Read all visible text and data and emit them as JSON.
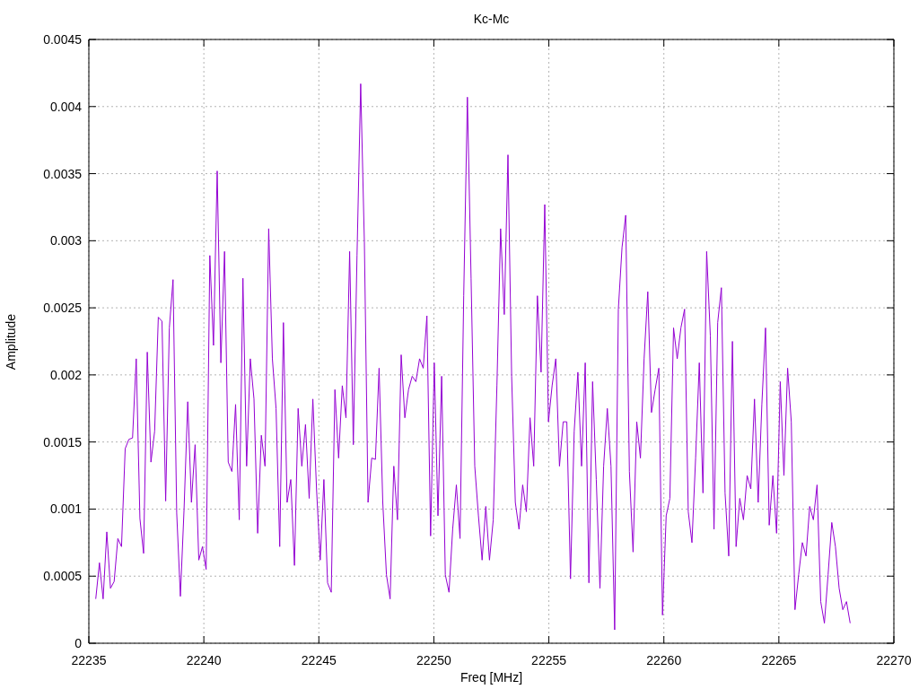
{
  "chart_data": {
    "type": "line",
    "title": "Kc-Mc",
    "xlabel": "Freq [MHz]",
    "ylabel": "Amplitude",
    "xlim": [
      22235,
      22270
    ],
    "ylim": [
      0,
      0.0045
    ],
    "xticks": [
      22235,
      22240,
      22245,
      22250,
      22255,
      22260,
      22265,
      22270
    ],
    "yticks": [
      0,
      0.0005,
      0.001,
      0.0015,
      0.002,
      0.0025,
      0.003,
      0.0035,
      0.004,
      0.0045
    ],
    "x": [
      22235.3,
      22235.46,
      22235.62,
      22235.78,
      22235.94,
      22236.1,
      22236.26,
      22236.42,
      22236.58,
      22236.74,
      22236.9,
      22237.06,
      22237.22,
      22237.38,
      22237.54,
      22237.7,
      22237.86,
      22238.02,
      22238.18,
      22238.34,
      22238.5,
      22238.66,
      22238.82,
      22238.98,
      22239.14,
      22239.3,
      22239.46,
      22239.62,
      22239.78,
      22239.94,
      22240.1,
      22240.26,
      22240.42,
      22240.58,
      22240.74,
      22240.9,
      22241.06,
      22241.22,
      22241.38,
      22241.54,
      22241.7,
      22241.86,
      22242.02,
      22242.18,
      22242.34,
      22242.5,
      22242.66,
      22242.82,
      22242.98,
      22243.14,
      22243.3,
      22243.46,
      22243.62,
      22243.78,
      22243.94,
      22244.1,
      22244.26,
      22244.42,
      22244.58,
      22244.74,
      22244.9,
      22245.06,
      22245.22,
      22245.38,
      22245.54,
      22245.7,
      22245.86,
      22246.02,
      22246.18,
      22246.34,
      22246.5,
      22246.66,
      22246.82,
      22246.98,
      22247.14,
      22247.3,
      22247.46,
      22247.62,
      22247.78,
      22247.94,
      22248.1,
      22248.26,
      22248.42,
      22248.58,
      22248.74,
      22248.9,
      22249.06,
      22249.22,
      22249.38,
      22249.54,
      22249.7,
      22249.86,
      22250.02,
      22250.18,
      22250.34,
      22250.5,
      22250.66,
      22250.82,
      22250.98,
      22251.14,
      22251.3,
      22251.46,
      22251.62,
      22251.78,
      22251.94,
      22252.1,
      22252.26,
      22252.42,
      22252.58,
      22252.74,
      22252.9,
      22253.06,
      22253.22,
      22253.38,
      22253.54,
      22253.7,
      22253.86,
      22254.02,
      22254.18,
      22254.34,
      22254.5,
      22254.66,
      22254.82,
      22254.98,
      22255.14,
      22255.3,
      22255.46,
      22255.62,
      22255.78,
      22255.94,
      22256.1,
      22256.26,
      22256.42,
      22256.58,
      22256.74,
      22256.9,
      22257.06,
      22257.22,
      22257.38,
      22257.54,
      22257.7,
      22257.86,
      22258.02,
      22258.18,
      22258.34,
      22258.5,
      22258.66,
      22258.82,
      22258.98,
      22259.14,
      22259.3,
      22259.46,
      22259.62,
      22259.78,
      22259.94,
      22260.1,
      22260.26,
      22260.42,
      22260.58,
      22260.74,
      22260.9,
      22261.06,
      22261.22,
      22261.38,
      22261.54,
      22261.7,
      22261.86,
      22262.02,
      22262.18,
      22262.34,
      22262.5,
      22262.66,
      22262.82,
      22262.98,
      22263.14,
      22263.3,
      22263.46,
      22263.62,
      22263.78,
      22263.94,
      22264.1,
      22264.26,
      22264.42,
      22264.58,
      22264.74,
      22264.9,
      22265.06,
      22265.22,
      22265.38,
      22265.54,
      22265.7,
      22265.86,
      22266.02,
      22266.18,
      22266.34,
      22266.5,
      22266.66,
      22266.82,
      22266.98,
      22267.14,
      22267.3,
      22267.46,
      22267.62,
      22267.78,
      22267.94,
      22268.1
    ],
    "grid": true,
    "series": [
      {
        "color": "#9400d3",
        "values": [
          0.00033,
          0.0006,
          0.00033,
          0.00083,
          0.00041,
          0.00046,
          0.00078,
          0.00072,
          0.00145,
          0.00152,
          0.00153,
          0.00212,
          0.00093,
          0.00067,
          0.00217,
          0.00135,
          0.00158,
          0.00243,
          0.0024,
          0.00106,
          0.00235,
          0.00271,
          0.00097,
          0.00035,
          0.001,
          0.0018,
          0.00105,
          0.00148,
          0.00062,
          0.00072,
          0.00055,
          0.00289,
          0.00222,
          0.00352,
          0.00209,
          0.00292,
          0.00135,
          0.00128,
          0.00178,
          0.00092,
          0.00272,
          0.00132,
          0.00212,
          0.00182,
          0.00082,
          0.00155,
          0.00132,
          0.00309,
          0.00212,
          0.00175,
          0.00072,
          0.00239,
          0.00105,
          0.00122,
          0.00058,
          0.00175,
          0.00132,
          0.00163,
          0.00108,
          0.00182,
          0.00115,
          0.00062,
          0.00122,
          0.00045,
          0.00038,
          0.00189,
          0.00138,
          0.00192,
          0.00168,
          0.00292,
          0.00148,
          0.00289,
          0.00417,
          0.00299,
          0.00105,
          0.00138,
          0.00137,
          0.00205,
          0.00105,
          0.00051,
          0.00033,
          0.00132,
          0.00092,
          0.00215,
          0.00168,
          0.00189,
          0.00199,
          0.00195,
          0.00212,
          0.00205,
          0.00244,
          0.0008,
          0.00209,
          0.00095,
          0.00199,
          0.00051,
          0.00038,
          0.00085,
          0.00118,
          0.00078,
          0.00259,
          0.00407,
          0.00272,
          0.00132,
          0.00095,
          0.00062,
          0.00102,
          0.00062,
          0.00092,
          0.00192,
          0.00309,
          0.00245,
          0.00364,
          0.00199,
          0.00105,
          0.00085,
          0.00118,
          0.00098,
          0.00168,
          0.00132,
          0.00259,
          0.00202,
          0.00327,
          0.00165,
          0.00192,
          0.00212,
          0.00132,
          0.00165,
          0.00165,
          0.00048,
          0.00158,
          0.00202,
          0.00132,
          0.00209,
          0.00045,
          0.00195,
          0.00122,
          0.00041,
          0.00132,
          0.00175,
          0.00132,
          0.0001,
          0.00249,
          0.00295,
          0.00319,
          0.00128,
          0.00068,
          0.00165,
          0.00138,
          0.00212,
          0.00262,
          0.00172,
          0.00189,
          0.00205,
          0.00021,
          0.00095,
          0.00108,
          0.00235,
          0.00212,
          0.00235,
          0.00249,
          0.00098,
          0.00075,
          0.00138,
          0.00209,
          0.00112,
          0.00292,
          0.00229,
          0.00085,
          0.00239,
          0.00265,
          0.00112,
          0.00065,
          0.00225,
          0.00072,
          0.00108,
          0.00092,
          0.00125,
          0.00115,
          0.00182,
          0.00105,
          0.00178,
          0.00235,
          0.00088,
          0.00125,
          0.00082,
          0.00195,
          0.00125,
          0.00205,
          0.00165,
          0.00025,
          0.00051,
          0.00075,
          0.00065,
          0.00102,
          0.00092,
          0.00118,
          0.00031,
          0.00015,
          0.00051,
          0.0009,
          0.00072,
          0.00041,
          0.00025,
          0.00031,
          0.00015
        ]
      }
    ]
  }
}
